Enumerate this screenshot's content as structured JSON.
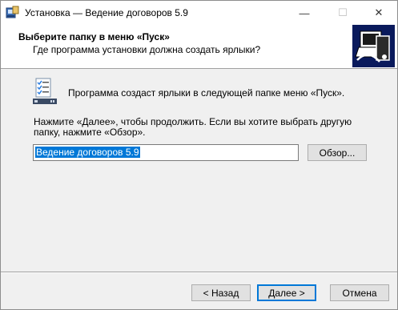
{
  "window": {
    "title": "Установка — Ведение договоров 5.9",
    "minimize_glyph": "—",
    "maximize_glyph": "☐",
    "close_glyph": "✕"
  },
  "header": {
    "title": "Выберите папку в меню «Пуск»",
    "subtitle": "Где программа установки должна создать ярлыки?"
  },
  "content": {
    "info_text": "Программа создаст ярлыки в следующей папке меню «Пуск».",
    "instructions": "Нажмите «Далее», чтобы продолжить. Если вы хотите выбрать другую папку, нажмите «Обзор».",
    "folder_value": "Ведение договоров 5.9"
  },
  "buttons": {
    "browse": "Обзор...",
    "back": "< Назад",
    "next": "Далее >",
    "cancel": "Отмена"
  },
  "colors": {
    "accent": "#0078d7",
    "header_bg": "#ffffff",
    "body_bg": "#f0f0f0",
    "header_image_bg": "#0a1a5c"
  },
  "icons": {
    "app": "installer-icon",
    "header": "computer-installer-icon",
    "content": "start-menu-checklist-icon"
  }
}
